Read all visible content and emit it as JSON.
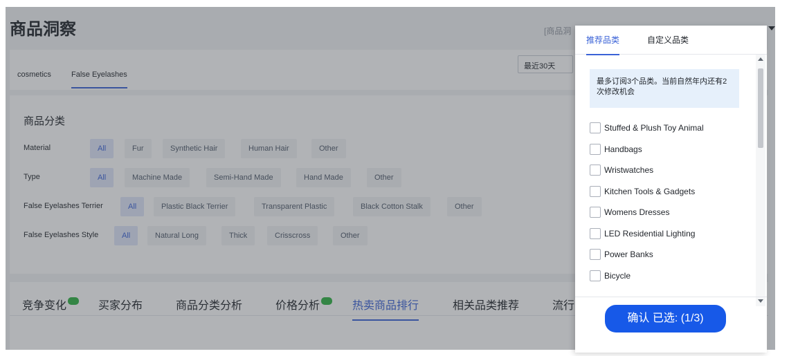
{
  "header": {
    "title": "商品洞察",
    "hint_text": "[商品洞"
  },
  "category_tabs": [
    {
      "label": "cosmetics"
    },
    {
      "label": "False Eyelashes",
      "active": true
    }
  ],
  "time_range": {
    "value": "最近30天"
  },
  "filters": {
    "section_title": "商品分类",
    "groups": [
      {
        "label": "Material",
        "chips": [
          "All",
          "Fur",
          "Synthetic Hair",
          "Human Hair",
          "Other"
        ]
      },
      {
        "label": "Type",
        "chips": [
          "All",
          "Machine Made",
          "Semi-Hand Made",
          "Hand Made",
          "Other"
        ]
      },
      {
        "label": "False Eyelashes Terrier",
        "chips": [
          "All",
          "Plastic Black Terrier",
          "Transparent Plastic",
          "Black Cotton Stalk",
          "Other"
        ]
      },
      {
        "label": "False Eyelashes Style",
        "chips": [
          "All",
          "Natural Long",
          "Thick",
          "Crisscross",
          "Other"
        ]
      }
    ]
  },
  "analysis_tabs": [
    {
      "label": "竞争变化",
      "badge": true
    },
    {
      "label": "买家分布"
    },
    {
      "label": "商品分类分析"
    },
    {
      "label": "价格分析",
      "badge": true
    },
    {
      "label": "热卖商品排行",
      "active": true
    },
    {
      "label": "相关品类推荐"
    },
    {
      "label": "流行"
    }
  ],
  "panel": {
    "tabs": [
      {
        "label": "推荐品类",
        "active": true
      },
      {
        "label": "自定义品类"
      }
    ],
    "notice": "最多订阅3个品类。当前自然年内还有2次修改机会",
    "options": [
      "Stuffed & Plush Toy Animal",
      "Handbags",
      "Wristwatches",
      "Kitchen Tools & Gadgets",
      "Womens Dresses",
      "LED Residential Lighting",
      "Power Banks",
      "Bicycle"
    ],
    "confirm_label": "确认 已选: (1/3)"
  },
  "colors": {
    "accent": "#3a62d7",
    "confirm": "#1759e8",
    "chip_active_bg": "#dfe7fb",
    "badge": "#2fb344"
  }
}
